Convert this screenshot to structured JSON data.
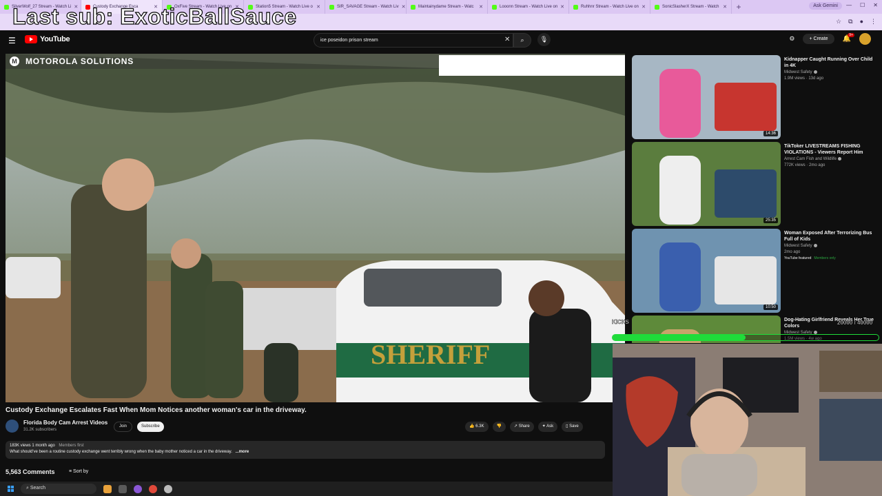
{
  "browser": {
    "tabs": [
      {
        "label": "SilverWolf_27 Stream - Watch Li",
        "kind": "kick"
      },
      {
        "label": "Custody Exchange Esca",
        "kind": "youtube",
        "active": true
      },
      {
        "label": "OxFive Stream - Watch Live on",
        "kind": "kick"
      },
      {
        "label": "Station5 Stream - Watch Live o",
        "kind": "kick"
      },
      {
        "label": "SIR_SAVAGE Stream - Watch Liv",
        "kind": "kick"
      },
      {
        "label": "Maintainydame Stream - Watc",
        "kind": "kick"
      },
      {
        "label": "Looonn Stream - Watch Live on",
        "kind": "kick"
      },
      {
        "label": "Ruhhnr Stream - Watch Live on",
        "kind": "kick"
      },
      {
        "label": "SonicSlasherX Stream - Watch",
        "kind": "kick"
      }
    ],
    "new_tab": "+",
    "ask_gemini": "Ask Gemini",
    "window_controls": [
      "—",
      "☐",
      "✕"
    ]
  },
  "stream_overlay": {
    "last_sub": "Last sub: ExoticBallSauce",
    "kicks_label": "KICKS",
    "goal_text": "20000 / 40000",
    "goal_fraction": 0.5
  },
  "youtube": {
    "logo_text": "YouTube",
    "search_value": "ice poseidon prison stream",
    "create_label": "Create",
    "notification_count": "9+"
  },
  "player": {
    "watermark": "MOTOROLA SOLUTIONS",
    "logo_glyph": "M"
  },
  "video": {
    "title": "Custody Exchange Escalates Fast When Mom Notices another woman's car in the driveway.",
    "channel": "Florida Body Cam Arrest Videos",
    "subscribers": "31.2K subscribers",
    "join_label": "Join",
    "subscribe_label": "Subscribe",
    "likes": "6.3K",
    "share_label": "Share",
    "ask_label": "Ask",
    "save_label": "Save",
    "views_date": "183K views  1 month ago",
    "members_first": "Members first",
    "description": "What should've been a routine custody exchange went terribly wrong when the baby mother noticed a car in the driveway.",
    "more_label": "...more"
  },
  "comments": {
    "count_label": "5,563 Comments",
    "sort_label": "Sort by"
  },
  "taskbar": {
    "search_placeholder": "Search"
  },
  "recommendations": [
    {
      "title": "Kidnapper Caught Running Over Child in 4K",
      "channel": "Midwest Safety",
      "meta": "1.9M views · 13d ago",
      "duration": "14:36"
    },
    {
      "title": "TikToker LIVESTREAMS FISHING VIOLATIONS - Viewers Report Him",
      "channel": "Arrest Cam Fish and Wildlife",
      "meta": "772K views · 2mo ago",
      "duration": "25:35"
    },
    {
      "title": "Woman Exposed After Terrorizing Bus Full of Kids",
      "channel": "Midwest Safety",
      "meta": "2mo ago",
      "duration": "10:50",
      "tag": "YouTube featured",
      "tag2": "Members only"
    },
    {
      "title": "Dog-Hating Girlfriend Reveals Her True Colors",
      "channel": "Midwest Safety",
      "meta": "1.5M views · 4w ago",
      "duration": ""
    }
  ],
  "colors": {
    "tab_strip": "#dcc8f3",
    "youtube_red": "#ff0000",
    "kick_green": "#53fc18",
    "goal_green": "#1fdc3a",
    "members_green": "#2ba640"
  }
}
